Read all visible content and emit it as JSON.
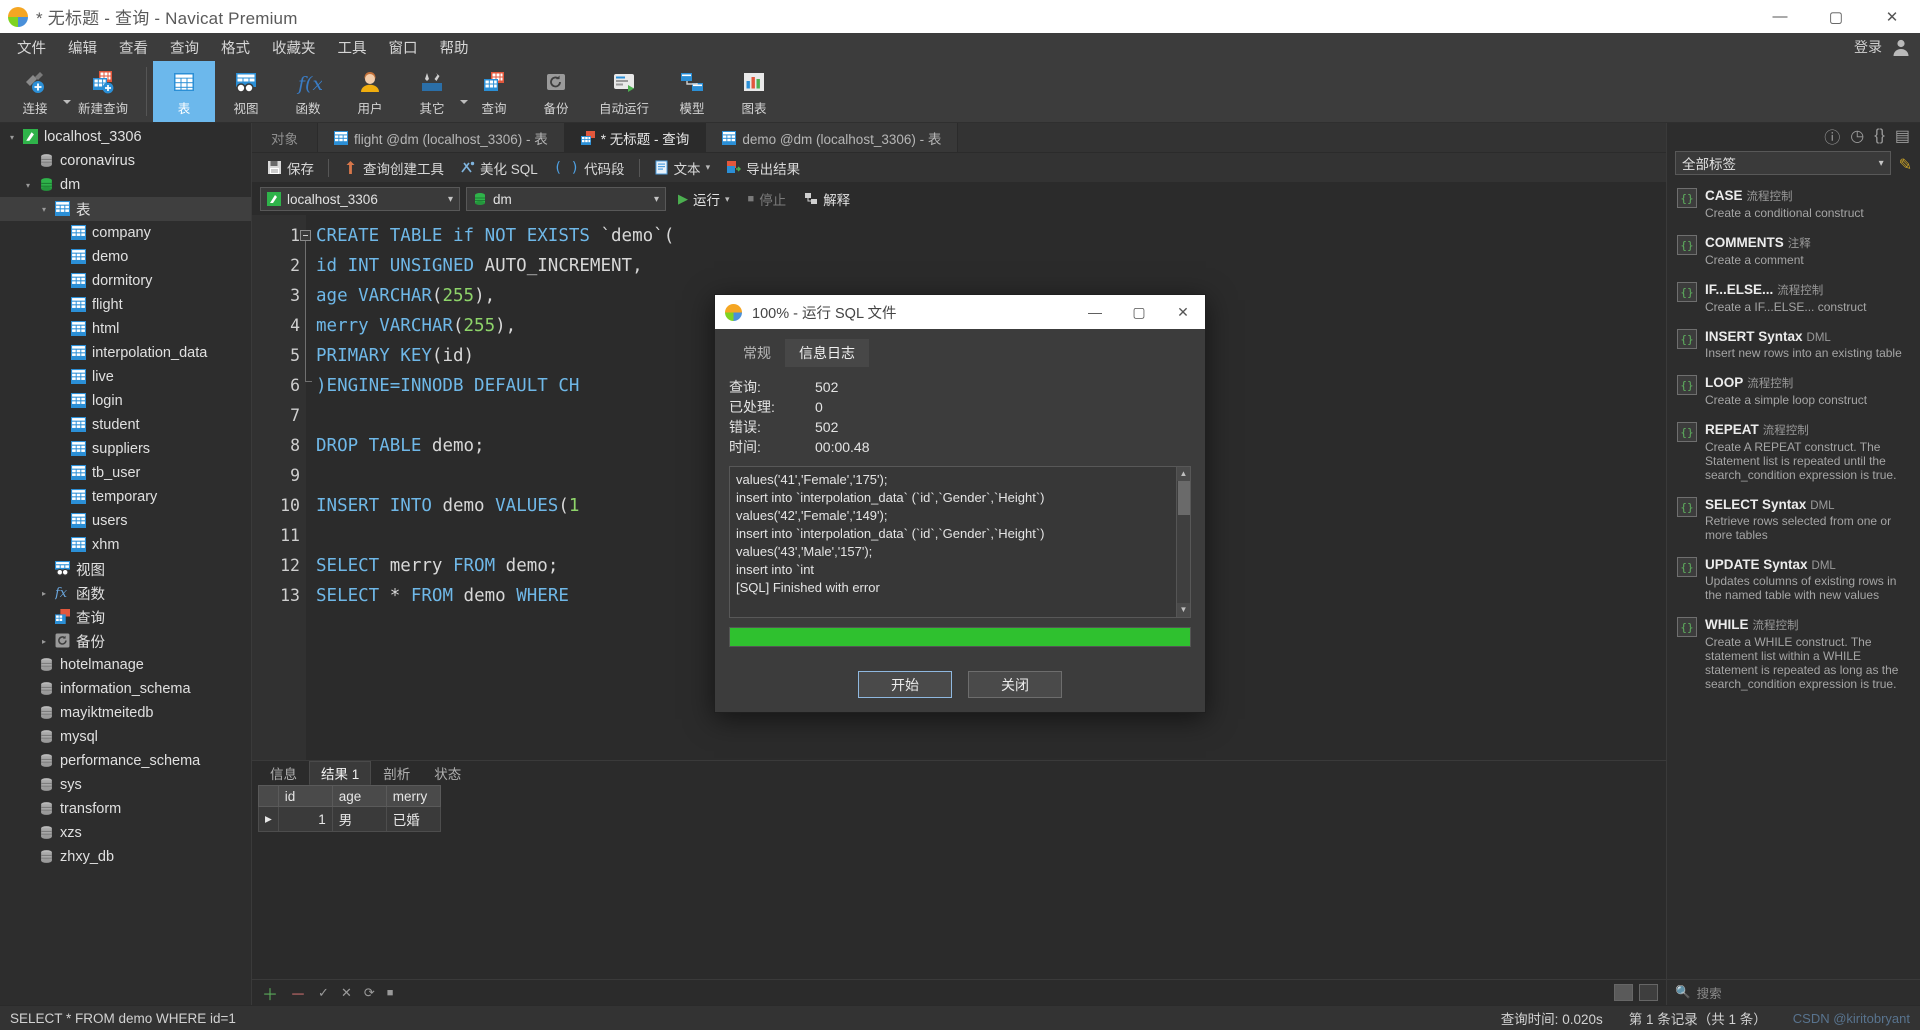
{
  "window": {
    "title": "* 无标题 - 查询 - Navicat Premium",
    "minimize": "—",
    "maximize": "▢",
    "close": "✕",
    "login_label": "登录"
  },
  "menubar": {
    "items": [
      "文件",
      "编辑",
      "查看",
      "查询",
      "格式",
      "收藏夹",
      "工具",
      "窗口",
      "帮助"
    ]
  },
  "ribbon": {
    "items": [
      {
        "label": "连接",
        "icon": "connection-icon",
        "caret": true
      },
      {
        "label": "新建查询",
        "icon": "new-query-icon",
        "caret": false
      },
      {
        "label": "表",
        "icon": "table-icon",
        "active": true
      },
      {
        "label": "视图",
        "icon": "view-icon",
        "active": false
      },
      {
        "label": "函数",
        "icon": "function-icon",
        "active": false
      },
      {
        "label": "用户",
        "icon": "user-icon",
        "active": false
      },
      {
        "label": "其它",
        "icon": "other-icon",
        "active": false,
        "caret": true
      },
      {
        "label": "查询",
        "icon": "query-icon",
        "active": false
      },
      {
        "label": "备份",
        "icon": "backup-icon",
        "active": false
      },
      {
        "label": "自动运行",
        "icon": "automation-icon",
        "active": false
      },
      {
        "label": "模型",
        "icon": "model-icon",
        "active": false
      },
      {
        "label": "图表",
        "icon": "chart-icon",
        "active": false
      }
    ]
  },
  "sidebar": {
    "items": [
      {
        "label": "localhost_3306",
        "indent": 0,
        "twisty": "▾",
        "icon": "connection-node-icon",
        "selected": false
      },
      {
        "label": "coronavirus",
        "indent": 1,
        "twisty": "",
        "icon": "database-icon",
        "selected": false
      },
      {
        "label": "dm",
        "indent": 1,
        "twisty": "▾",
        "icon": "database-open-icon",
        "selected": false
      },
      {
        "label": "表",
        "indent": 2,
        "twisty": "▾",
        "icon": "tables-folder-icon",
        "selected": true
      },
      {
        "label": "company",
        "indent": 3,
        "twisty": "",
        "icon": "table-item-icon",
        "selected": false
      },
      {
        "label": "demo",
        "indent": 3,
        "twisty": "",
        "icon": "table-item-icon",
        "selected": false
      },
      {
        "label": "dormitory",
        "indent": 3,
        "twisty": "",
        "icon": "table-item-icon",
        "selected": false
      },
      {
        "label": "flight",
        "indent": 3,
        "twisty": "",
        "icon": "table-item-icon",
        "selected": false
      },
      {
        "label": "html",
        "indent": 3,
        "twisty": "",
        "icon": "table-item-icon",
        "selected": false
      },
      {
        "label": "interpolation_data",
        "indent": 3,
        "twisty": "",
        "icon": "table-item-icon",
        "selected": false
      },
      {
        "label": "live",
        "indent": 3,
        "twisty": "",
        "icon": "table-item-icon",
        "selected": false
      },
      {
        "label": "login",
        "indent": 3,
        "twisty": "",
        "icon": "table-item-icon",
        "selected": false
      },
      {
        "label": "student",
        "indent": 3,
        "twisty": "",
        "icon": "table-item-icon",
        "selected": false
      },
      {
        "label": "suppliers",
        "indent": 3,
        "twisty": "",
        "icon": "table-item-icon",
        "selected": false
      },
      {
        "label": "tb_user",
        "indent": 3,
        "twisty": "",
        "icon": "table-item-icon",
        "selected": false
      },
      {
        "label": "temporary",
        "indent": 3,
        "twisty": "",
        "icon": "table-item-icon",
        "selected": false
      },
      {
        "label": "users",
        "indent": 3,
        "twisty": "",
        "icon": "table-item-icon",
        "selected": false
      },
      {
        "label": "xhm",
        "indent": 3,
        "twisty": "",
        "icon": "table-item-icon",
        "selected": false
      },
      {
        "label": "视图",
        "indent": 2,
        "twisty": "",
        "icon": "views-folder-icon",
        "selected": false
      },
      {
        "label": "函数",
        "indent": 2,
        "twisty": "▸",
        "icon": "functions-folder-icon",
        "selected": false
      },
      {
        "label": "查询",
        "indent": 2,
        "twisty": "",
        "icon": "queries-folder-icon",
        "selected": false
      },
      {
        "label": "备份",
        "indent": 2,
        "twisty": "▸",
        "icon": "backups-folder-icon",
        "selected": false
      },
      {
        "label": "hotelmanage",
        "indent": 1,
        "twisty": "",
        "icon": "database-icon",
        "selected": false
      },
      {
        "label": "information_schema",
        "indent": 1,
        "twisty": "",
        "icon": "database-icon",
        "selected": false
      },
      {
        "label": "mayiktmeitedb",
        "indent": 1,
        "twisty": "",
        "icon": "database-icon",
        "selected": false
      },
      {
        "label": "mysql",
        "indent": 1,
        "twisty": "",
        "icon": "database-icon",
        "selected": false
      },
      {
        "label": "performance_schema",
        "indent": 1,
        "twisty": "",
        "icon": "database-icon",
        "selected": false
      },
      {
        "label": "sys",
        "indent": 1,
        "twisty": "",
        "icon": "database-icon",
        "selected": false
      },
      {
        "label": "transform",
        "indent": 1,
        "twisty": "",
        "icon": "database-icon",
        "selected": false
      },
      {
        "label": "xzs",
        "indent": 1,
        "twisty": "",
        "icon": "database-icon",
        "selected": false
      },
      {
        "label": "zhxy_db",
        "indent": 1,
        "twisty": "",
        "icon": "database-icon",
        "selected": false
      }
    ]
  },
  "tabstrip": {
    "object_label": "对象",
    "tabs": [
      {
        "label": "flight @dm (localhost_3306) - 表",
        "active": false,
        "icon": "table-tab-icon"
      },
      {
        "label": "* 无标题 - 查询",
        "active": true,
        "icon": "query-tab-icon"
      },
      {
        "label": "demo @dm (localhost_3306) - 表",
        "active": false,
        "icon": "table-tab-icon"
      }
    ]
  },
  "query_toolbar": {
    "buttons": [
      {
        "label": "保存",
        "icon": "save-icon"
      },
      {
        "label": "查询创建工具",
        "icon": "query-builder-icon"
      },
      {
        "label": "美化 SQL",
        "icon": "beautify-sql-icon"
      },
      {
        "label": "代码段",
        "icon": "code-snippet-icon"
      },
      {
        "label": "文本",
        "icon": "text-icon",
        "caret": true
      },
      {
        "label": "导出结果",
        "icon": "export-result-icon"
      }
    ]
  },
  "connection_bar": {
    "connection": "localhost_3306",
    "database": "dm",
    "run_label": "运行",
    "stop_label": "停止",
    "explain_label": "解释",
    "chevron": "⌄"
  },
  "editor": {
    "lines": [
      {
        "n": 1,
        "tokens": [
          {
            "t": "CREATE TABLE if NOT EXISTS ",
            "c": "kw"
          },
          {
            "t": "`demo`(",
            "c": "pl"
          }
        ]
      },
      {
        "n": 2,
        "tokens": [
          {
            "t": "id INT UNSIGNED ",
            "c": "kw"
          },
          {
            "t": "AUTO_INCREMENT,",
            "c": "pl"
          }
        ]
      },
      {
        "n": 3,
        "tokens": [
          {
            "t": "age VARCHAR",
            "c": "kw"
          },
          {
            "t": "(",
            "c": "pl"
          },
          {
            "t": "255",
            "c": "num"
          },
          {
            "t": "),",
            "c": "pl"
          }
        ]
      },
      {
        "n": 4,
        "tokens": [
          {
            "t": "merry VARCHAR",
            "c": "kw"
          },
          {
            "t": "(",
            "c": "pl"
          },
          {
            "t": "255",
            "c": "num"
          },
          {
            "t": "),",
            "c": "pl"
          }
        ]
      },
      {
        "n": 5,
        "tokens": [
          {
            "t": "PRIMARY KEY",
            "c": "kw"
          },
          {
            "t": "(id)",
            "c": "pl"
          }
        ]
      },
      {
        "n": 6,
        "tokens": [
          {
            "t": ")ENGINE=INNODB DEFAULT CH",
            "c": "kw"
          }
        ]
      },
      {
        "n": 7,
        "tokens": []
      },
      {
        "n": 8,
        "tokens": [
          {
            "t": "DROP TABLE ",
            "c": "kw"
          },
          {
            "t": "demo;",
            "c": "pl"
          }
        ]
      },
      {
        "n": 9,
        "tokens": []
      },
      {
        "n": 10,
        "tokens": [
          {
            "t": "INSERT INTO ",
            "c": "kw"
          },
          {
            "t": "demo ",
            "c": "pl"
          },
          {
            "t": "VALUES",
            "c": "kw"
          },
          {
            "t": "(",
            "c": "pl"
          },
          {
            "t": "1",
            "c": "num"
          }
        ]
      },
      {
        "n": 11,
        "tokens": []
      },
      {
        "n": 12,
        "tokens": [
          {
            "t": "SELECT ",
            "c": "kw"
          },
          {
            "t": "merry ",
            "c": "pl"
          },
          {
            "t": "FROM ",
            "c": "kw"
          },
          {
            "t": "demo;",
            "c": "pl"
          }
        ]
      },
      {
        "n": 13,
        "tokens": [
          {
            "t": "SELECT ",
            "c": "kw"
          },
          {
            "t": "* ",
            "c": "pl"
          },
          {
            "t": "FROM ",
            "c": "kw"
          },
          {
            "t": "demo ",
            "c": "pl"
          },
          {
            "t": "WHERE",
            "c": "kw"
          }
        ]
      }
    ]
  },
  "results": {
    "tabs": [
      {
        "label": "信息",
        "active": false
      },
      {
        "label": "结果 1",
        "active": true
      },
      {
        "label": "剖析",
        "active": false
      },
      {
        "label": "状态",
        "active": false
      }
    ],
    "columns": [
      "id",
      "age",
      "merry"
    ],
    "rows": [
      [
        "1",
        "男",
        "已婚"
      ]
    ],
    "footer_icons": [
      "add-row-icon",
      "remove-row-icon",
      "apply-icon",
      "cancel-icon",
      "refresh-icon",
      "stop-icon"
    ],
    "view_toggle": [
      "grid-view-icon",
      "form-view-icon"
    ]
  },
  "right_panel": {
    "header_icons": [
      "info-icon",
      "history-icon",
      "code-icon",
      "panel-icon"
    ],
    "filter_value": "全部标签",
    "chevron": "⌄",
    "search_placeholder": "搜索",
    "snippets": [
      {
        "title": "CASE",
        "kind": "流程控制",
        "desc": "Create a conditional construct"
      },
      {
        "title": "COMMENTS",
        "kind": "注释",
        "desc": "Create a comment"
      },
      {
        "title": "IF...ELSE...",
        "kind": "流程控制",
        "desc": "Create a IF...ELSE... construct"
      },
      {
        "title": "INSERT Syntax",
        "kind": "DML",
        "desc": "Insert new rows into an existing table"
      },
      {
        "title": "LOOP",
        "kind": "流程控制",
        "desc": "Create a simple loop construct"
      },
      {
        "title": "REPEAT",
        "kind": "流程控制",
        "desc": "Create A REPEAT construct. The Statement list is repeated until the search_condition expression is true."
      },
      {
        "title": "SELECT Syntax",
        "kind": "DML",
        "desc": "Retrieve rows selected from one or more tables"
      },
      {
        "title": "UPDATE Syntax",
        "kind": "DML",
        "desc": "Updates columns of existing rows in the named table with new values"
      },
      {
        "title": "WHILE",
        "kind": "流程控制",
        "desc": "Create a WHILE construct. The statement list within a WHILE statement is repeated as long as the search_condition expression is true."
      }
    ]
  },
  "statusbar": {
    "left_text": "SELECT * FROM demo WHERE id=1",
    "query_time": "查询时间: 0.020s",
    "record_info": "第 1 条记录（共 1 条）",
    "watermark": "CSDN @kiritobryant"
  },
  "dialog": {
    "title": "100% - 运行 SQL 文件",
    "minimize": "—",
    "maximize": "▢",
    "close": "✕",
    "tabs": [
      {
        "label": "常规",
        "active": false
      },
      {
        "label": "信息日志",
        "active": true
      }
    ],
    "stats": [
      {
        "key": "查询:",
        "value": "502"
      },
      {
        "key": "已处理:",
        "value": "0"
      },
      {
        "key": "错误:",
        "value": "502"
      },
      {
        "key": "时间:",
        "value": "00:00.48"
      }
    ],
    "log_lines": [
      "values('41','Female','175');",
      "insert into `interpolation_data` (`id`,`Gender`,`Height`)",
      "values('42','Female','149');",
      "insert into `interpolation_data` (`id`,`Gender`,`Height`)",
      "values('43','Male','157');",
      "insert into `int",
      "[SQL] Finished with error"
    ],
    "progress_percent": 100,
    "progress_color": "#2fc12f",
    "buttons": [
      {
        "label": "开始",
        "default": true
      },
      {
        "label": "关闭",
        "default": false
      }
    ]
  }
}
